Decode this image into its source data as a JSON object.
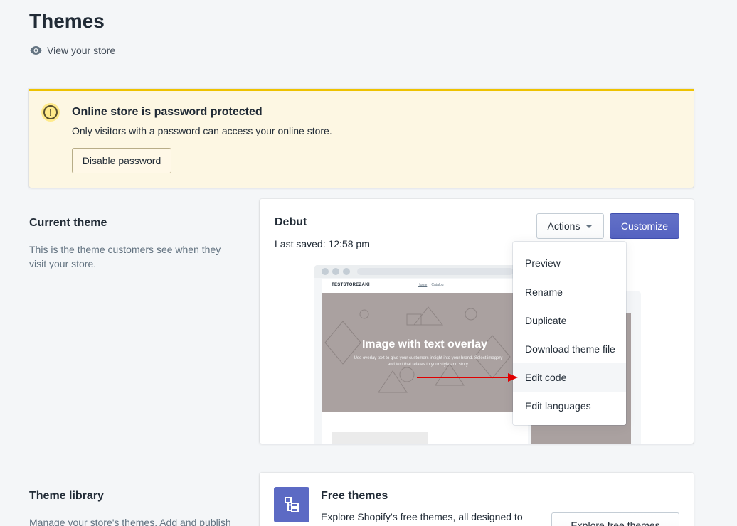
{
  "header": {
    "title": "Themes",
    "view_store_label": "View your store"
  },
  "banner": {
    "title": "Online store is password protected",
    "text": "Only visitors with a password can access your online store.",
    "button_label": "Disable password",
    "accent_color": "#eec200"
  },
  "current_theme": {
    "section_title": "Current theme",
    "section_desc": "This is the theme customers see when they visit your store.",
    "theme_name": "Debut",
    "last_saved": "Last saved: 12:58 pm",
    "actions_label": "Actions",
    "customize_label": "Customize",
    "preview": {
      "store_name": "TESTSTOREZAKI",
      "nav": [
        "Home",
        "Catalog"
      ],
      "hero_title": "Image with text overlay",
      "hero_sub": "Use overlay text to give your customers insight into your brand. Select imagery and text that relates to your style and story."
    }
  },
  "actions_menu": {
    "items": [
      "Preview",
      "Rename",
      "Duplicate",
      "Download theme file",
      "Edit code",
      "Edit languages"
    ],
    "highlighted": "Edit code"
  },
  "theme_library": {
    "section_title": "Theme library",
    "section_desc": "Manage your store's themes. Add and publish",
    "card_title": "Free themes",
    "card_text": "Explore Shopify's free themes, all designed to",
    "explore_label": "Explore free themes"
  },
  "colors": {
    "primary": "#5c6ac4",
    "annotation_arrow": "#e00000"
  }
}
